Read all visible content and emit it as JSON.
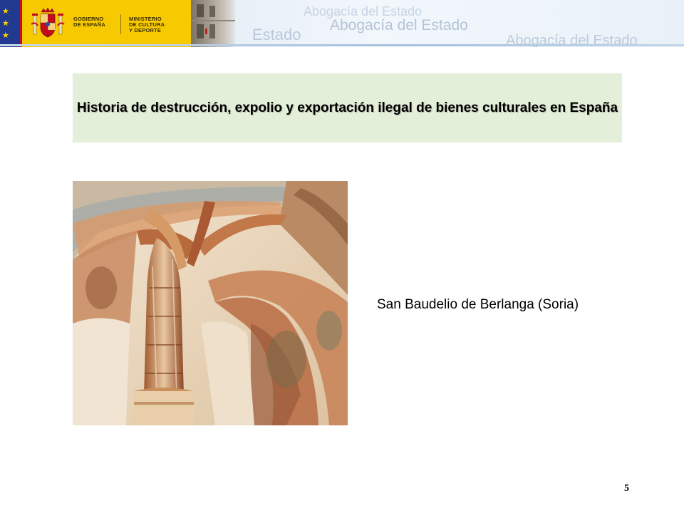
{
  "header": {
    "government_lines": "GOBIERNO\nDE ESPAÑA",
    "ministry_lines": "MINISTERIO\nDE CULTURA\nY DEPORTE",
    "watermark_1": "Abogacía del Estado",
    "watermark_2": "Abogacía del Estado",
    "watermark_3": "Estado",
    "watermark_4": "Abogacía del Estado",
    "colors": {
      "flag_yellow": "#f7c900",
      "flag_red": "#c60b1e",
      "eu_blue": "#213a8f",
      "title_bg": "#e4efd9"
    }
  },
  "slide": {
    "title": "Historia de destrucción, expolio y exportación ilegal de bienes culturales en España",
    "caption": "San Baudelio de Berlanga (Soria)",
    "page_number": "5"
  }
}
